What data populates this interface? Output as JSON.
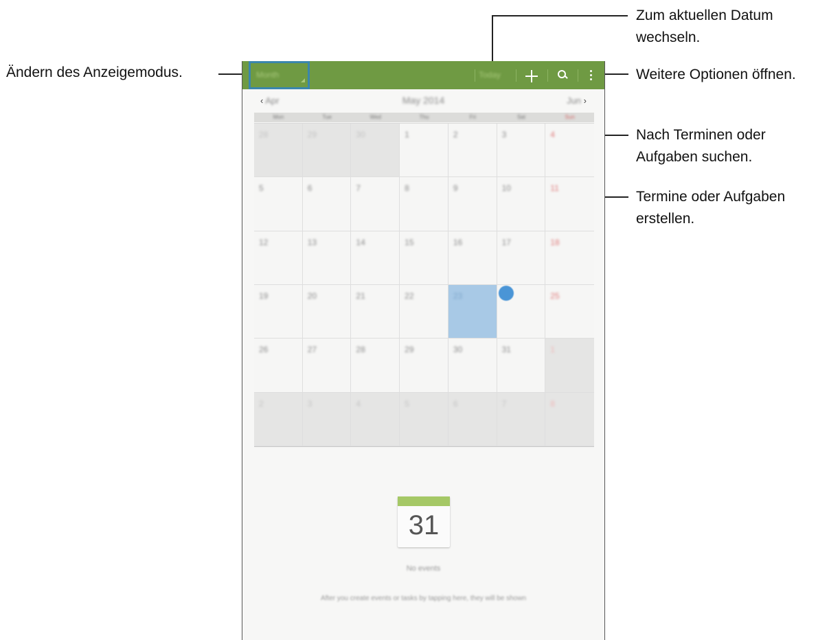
{
  "annotations": {
    "view_mode": "Ändern des Anzeigemodus.",
    "today": [
      "Zum aktuellen Datum",
      "wechseln."
    ],
    "more": "Weitere Optionen öffnen.",
    "search": [
      "Nach Terminen oder",
      "Aufgaben suchen."
    ],
    "add": [
      "Termine oder Aufgaben",
      "erstellen."
    ]
  },
  "action_bar": {
    "view_mode_label": "Month",
    "today_label": "Today",
    "add_icon": "plus-icon",
    "search_icon": "search-icon",
    "more_icon": "overflow-menu-icon",
    "color": "#6f9a43"
  },
  "month_nav": {
    "prev_arrow": "‹",
    "prev_label": "Apr",
    "title": "May 2014",
    "next_label": "Jun",
    "next_arrow": "›"
  },
  "weekdays": [
    "Mon",
    "Tue",
    "Wed",
    "Thu",
    "Fri",
    "Sat",
    "Sun"
  ],
  "weeks": [
    [
      "28",
      "29",
      "30",
      "1",
      "2",
      "3",
      "4"
    ],
    [
      "5",
      "6",
      "7",
      "8",
      "9",
      "10",
      "11"
    ],
    [
      "12",
      "13",
      "14",
      "15",
      "16",
      "17",
      "18"
    ],
    [
      "19",
      "20",
      "21",
      "22",
      "23",
      "24",
      "25"
    ],
    [
      "26",
      "27",
      "28",
      "29",
      "30",
      "31",
      "1"
    ],
    [
      "2",
      "3",
      "4",
      "5",
      "6",
      "7",
      "8"
    ]
  ],
  "selected_day": "23",
  "today_day": "24",
  "empty_state": {
    "icon_day": "31",
    "title": "No events",
    "hint": "After you create events or tasks by tapping here, they will be shown"
  }
}
